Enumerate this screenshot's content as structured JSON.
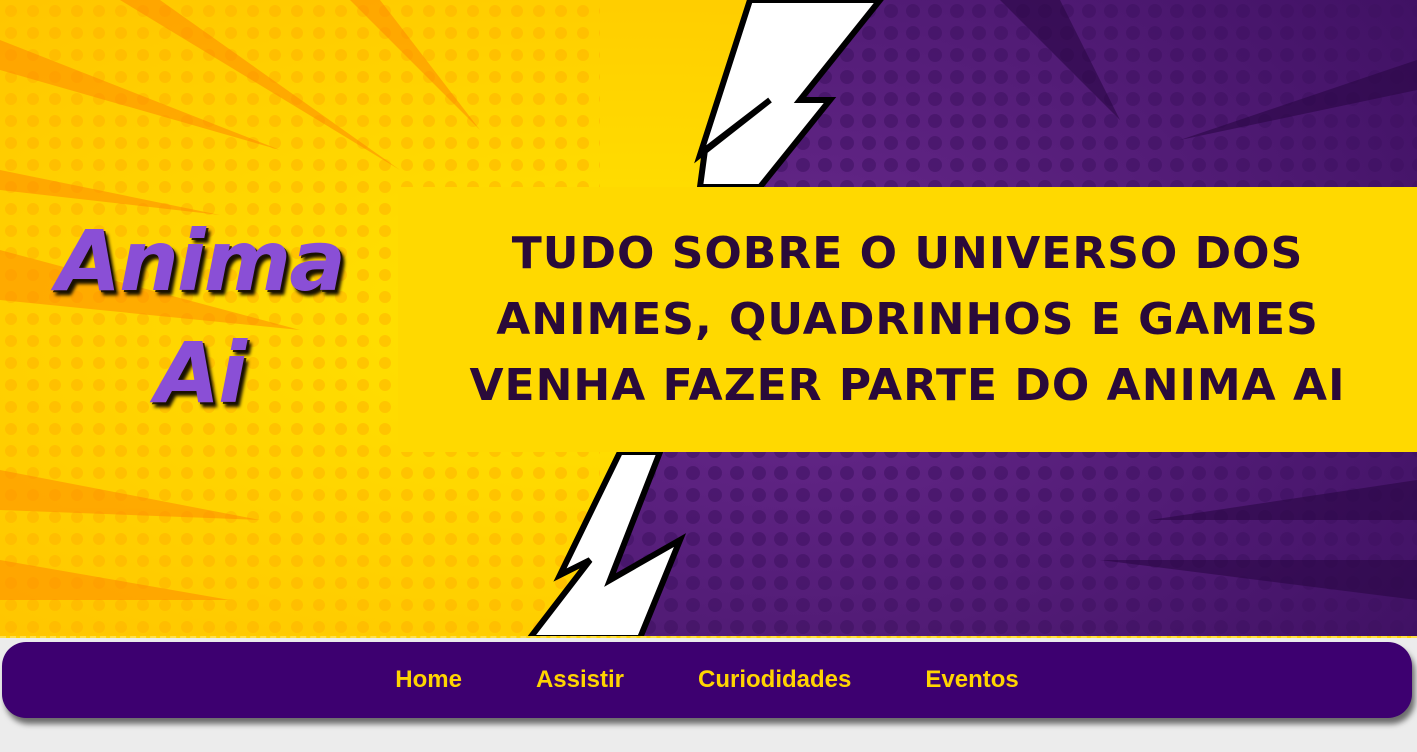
{
  "logo": {
    "line1": "Anima",
    "line2": "Ai"
  },
  "banner": {
    "line1": "TUDO SOBRE O UNIVERSO DOS",
    "line2": "ANIMES, QUADRINHOS E GAMES",
    "line3": "VENHA FAZER PARTE DO ANIMA AI"
  },
  "nav": {
    "items": [
      {
        "label": "Home"
      },
      {
        "label": "Assistir"
      },
      {
        "label": "Curiodidades"
      },
      {
        "label": "Eventos"
      }
    ]
  },
  "colors": {
    "yellow": "#ffd400",
    "purple": "#5a1d7a",
    "nav_bg": "#3d0070",
    "nav_text": "#ffd400",
    "logo": "#8a4fd6",
    "banner_text": "#2a0a3a"
  },
  "icons": [
    "lightning-bolt-icon"
  ]
}
